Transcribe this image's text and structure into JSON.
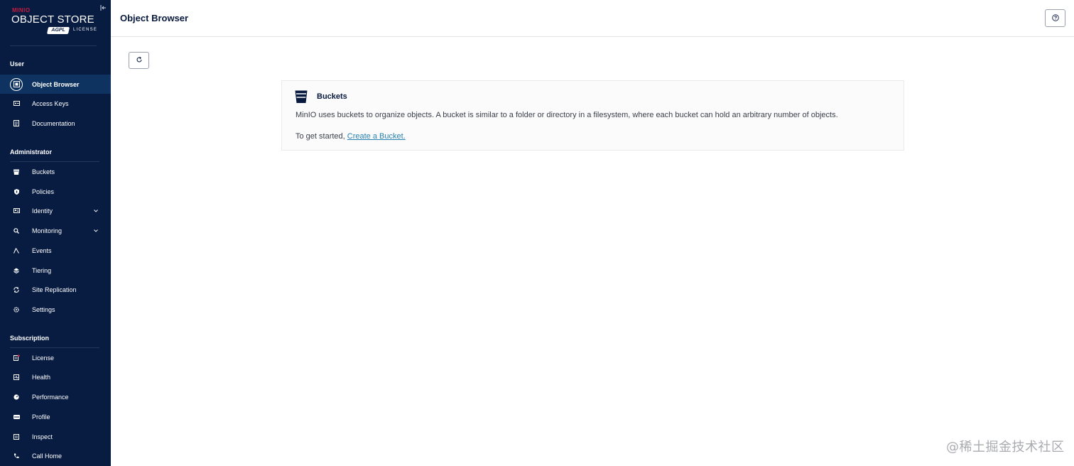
{
  "brand": {
    "minio": "MINIO",
    "product": "OBJECT STORE",
    "badge": "AGPL",
    "license": "LICENSE"
  },
  "header": {
    "title": "Object Browser"
  },
  "sidebar": {
    "sections": [
      {
        "title": "User",
        "items": [
          {
            "label": "Object Browser",
            "icon": "object-browser-icon",
            "active": true
          },
          {
            "label": "Access Keys",
            "icon": "access-keys-icon"
          },
          {
            "label": "Documentation",
            "icon": "documentation-icon"
          }
        ]
      },
      {
        "title": "Administrator",
        "items": [
          {
            "label": "Buckets",
            "icon": "buckets-icon"
          },
          {
            "label": "Policies",
            "icon": "policies-icon"
          },
          {
            "label": "Identity",
            "icon": "identity-icon",
            "expandable": true
          },
          {
            "label": "Monitoring",
            "icon": "monitoring-icon",
            "expandable": true
          },
          {
            "label": "Events",
            "icon": "events-icon"
          },
          {
            "label": "Tiering",
            "icon": "tiering-icon"
          },
          {
            "label": "Site Replication",
            "icon": "site-replication-icon"
          },
          {
            "label": "Settings",
            "icon": "settings-icon"
          }
        ]
      },
      {
        "title": "Subscription",
        "items": [
          {
            "label": "License",
            "icon": "license-icon"
          },
          {
            "label": "Health",
            "icon": "health-icon"
          },
          {
            "label": "Performance",
            "icon": "performance-icon"
          },
          {
            "label": "Profile",
            "icon": "profile-icon"
          },
          {
            "label": "Inspect",
            "icon": "inspect-icon"
          },
          {
            "label": "Call Home",
            "icon": "call-home-icon"
          }
        ]
      }
    ]
  },
  "empty_state": {
    "title": "Buckets",
    "description": "MinIO uses buckets to organize objects. A bucket is similar to a folder or directory in a filesystem, where each bucket can hold an arbitrary number of objects.",
    "start_prefix": "To get started,",
    "start_link": "Create a Bucket."
  },
  "watermark": "@稀土掘金技术社区",
  "colors": {
    "sidebar_bg": "#081c42",
    "sidebar_active": "#0f3360",
    "link": "#2781b0",
    "brand_red": "#c51c3f"
  }
}
